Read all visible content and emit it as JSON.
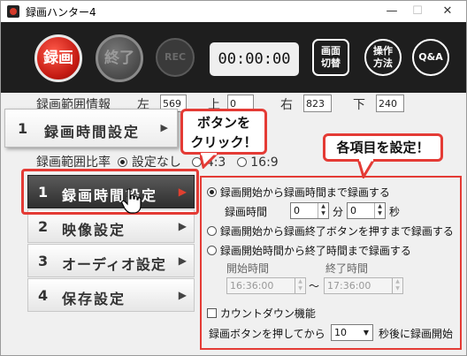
{
  "window": {
    "title": "録画ハンター4",
    "minimize": "—",
    "maximize": "☐",
    "close": "✕"
  },
  "toolbar": {
    "record_label": "録画",
    "stop_label": "終了",
    "rec_label": "REC",
    "timer": "00:00:00",
    "screen_switch_label_1": "画面",
    "screen_switch_label_2": "切替",
    "how_to_label_1": "操作",
    "how_to_label_2": "方法",
    "qa_label": "Q&A"
  },
  "capture_range": {
    "label": "録画範囲情報",
    "left_label": "左",
    "left_value": "569",
    "top_label": "上",
    "top_value": "0",
    "right_label": "右",
    "right_value": "823",
    "bottom_label": "下",
    "bottom_value": "240"
  },
  "aspect": {
    "label": "録画範囲比率",
    "option_free": "設定なし",
    "option_43": "4:3",
    "option_169": "16:9"
  },
  "menu": {
    "items": [
      {
        "num": "1",
        "label": "録画時間設定"
      },
      {
        "num": "2",
        "label": "映像設定"
      },
      {
        "num": "3",
        "label": "オーディオ設定"
      },
      {
        "num": "4",
        "label": "保存設定"
      }
    ],
    "arrow": "▶"
  },
  "overlay": {
    "num": "1",
    "label": "録画時間設定",
    "arrow": "▶"
  },
  "callouts": {
    "click_line1": "ボタンを",
    "click_line2": "クリック！",
    "set_items": "各項目を設定！"
  },
  "panel": {
    "option1": "録画開始から録画時間まで録画する",
    "duration_label": "録画時間",
    "minutes_value": "0",
    "minutes_unit": "分",
    "seconds_value": "0",
    "seconds_unit": "秒",
    "option2": "録画開始から録画終了ボタンを押すまで録画する",
    "option3": "録画開始時間から終了時間まで録画する",
    "start_time_label": "開始時間",
    "end_time_label": "終了時間",
    "start_time_value": "16:36:00",
    "end_time_value": "17:36:00",
    "tilde": "〜",
    "countdown_label": "カウントダウン機能",
    "countdown_prefix": "録画ボタンを押してから",
    "countdown_value": "10",
    "countdown_suffix": "秒後に録画開始"
  }
}
